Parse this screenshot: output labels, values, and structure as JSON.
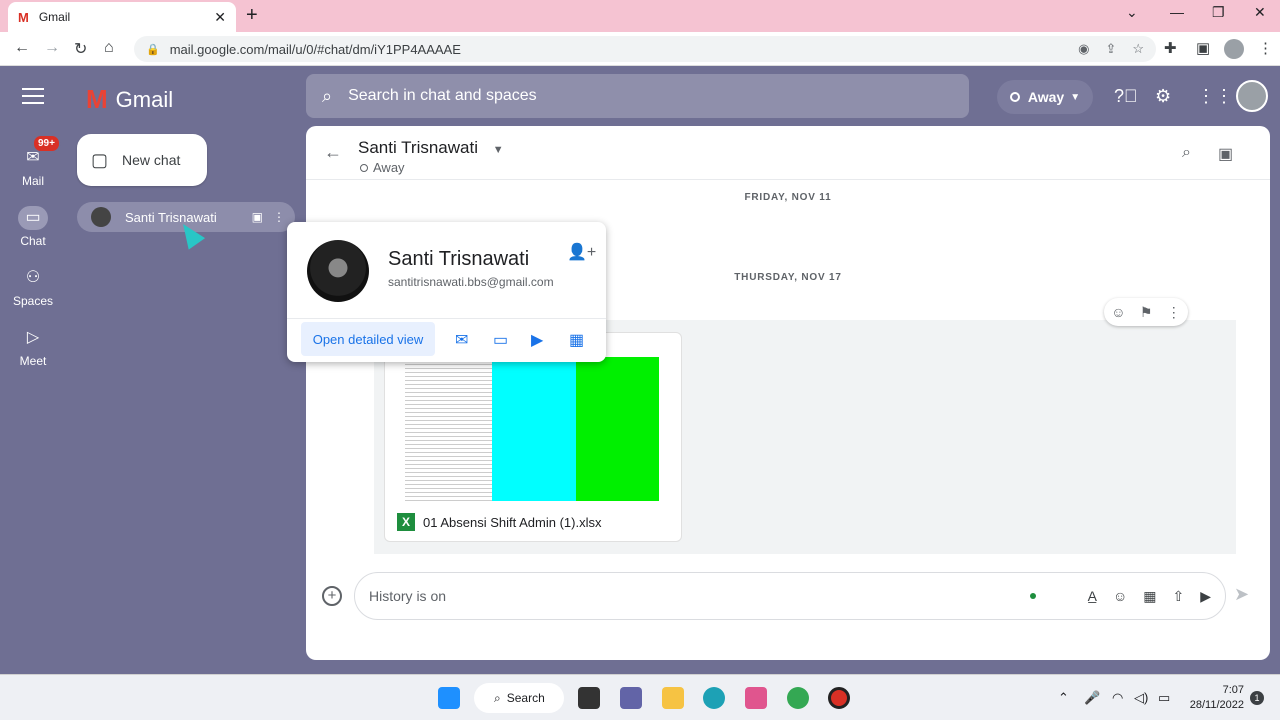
{
  "browser": {
    "tab_title": "Gmail",
    "tab_favicon": "M",
    "url": "mail.google.com/mail/u/0/#chat/dm/iY1PP4AAAAE"
  },
  "rail": {
    "mail_label": "Mail",
    "mail_badge": "99+",
    "chat_label": "Chat",
    "spaces_label": "Spaces",
    "meet_label": "Meet"
  },
  "app": {
    "logo_text": "Gmail",
    "new_chat_label": "New chat",
    "search_placeholder": "Search in chat and spaces",
    "status_label": "Away"
  },
  "sidebar": {
    "dm_name": "Santi Trisnawati"
  },
  "conversation": {
    "name": "Santi Trisnawati",
    "status": "Away",
    "date_1": "FRIDAY, NOV 11",
    "date_2": "THURSDAY, NOV 17",
    "attachment_name": "01 Absensi Shift Admin (1).xlsx",
    "composer_placeholder": "History is on"
  },
  "contact_card": {
    "name": "Santi Trisnawati",
    "email": "santitrisnawati.bbs@gmail.com",
    "open_detailed_label": "Open detailed view"
  },
  "taskbar": {
    "search_label": "Search",
    "time": "7:07",
    "date": "28/11/2022",
    "notification_count": "1"
  },
  "colors": {
    "app_bg": "#6f6f93",
    "accent": "#1a73e8",
    "tab_strip": "#f5c3d2",
    "sheet_cyan": "#00ffff",
    "sheet_green": "#00f000"
  }
}
